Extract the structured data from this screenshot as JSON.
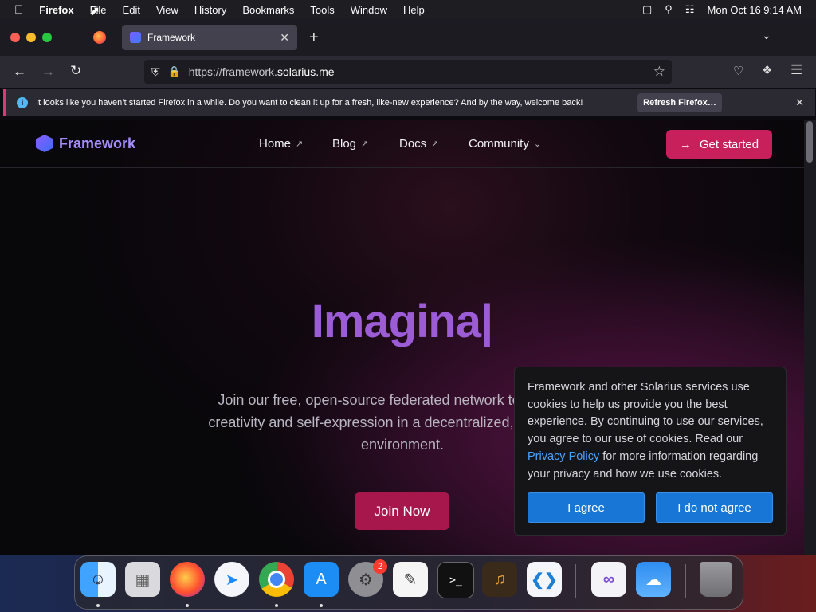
{
  "menubar": {
    "app_name": "Firefox",
    "items": [
      "File",
      "Edit",
      "View",
      "History",
      "Bookmarks",
      "Tools",
      "Window",
      "Help"
    ],
    "datetime": "Mon Oct 16  9:14 AM"
  },
  "browser": {
    "tab_title": "Framework",
    "url_prefix": "https://framework.",
    "url_domain": "solarius.me",
    "notification": "It looks like you haven’t started Firefox in a while. Do you want to clean it up for a fresh, like-new experience? And by the way, welcome back!",
    "refresh_label": "Refresh Firefox…"
  },
  "site": {
    "logo_text": "Framework",
    "nav": [
      "Home",
      "Blog",
      "Docs",
      "Community"
    ],
    "cta_label": "Get started",
    "headline": "Imagina|",
    "subtitle_line1": "Join our free, open-source federated network to explore th",
    "subtitle_line2": "creativity and self-expression in a decentralized, censorship-r",
    "subtitle_line3": "environment.",
    "join_label": "Join Now"
  },
  "cookie": {
    "text_before": "Framework and other Solarius services use cookies to help us provide you the best experience. By continuing to use our services, you agree to our use of cookies. Read our ",
    "link": "Privacy Policy",
    "text_after": " for more information regarding your privacy and how we use cookies.",
    "agree": "I agree",
    "disagree": "I do not agree"
  },
  "dock": {
    "settings_badge": "2",
    "apps": [
      "finder-icon",
      "launchpad-icon",
      "firefox-icon",
      "safari-icon",
      "chrome-icon",
      "app-store-icon",
      "system-settings-icon",
      "textedit-icon",
      "terminal-icon",
      "garageband-icon",
      "vscode-icon",
      "visual-studio-icon",
      "weather-icon",
      "trash-icon"
    ]
  },
  "colors": {
    "accent": "#c8205a",
    "headline": "#9b5cd6",
    "cookie_button": "#1877d6",
    "link": "#4aa3ff"
  }
}
